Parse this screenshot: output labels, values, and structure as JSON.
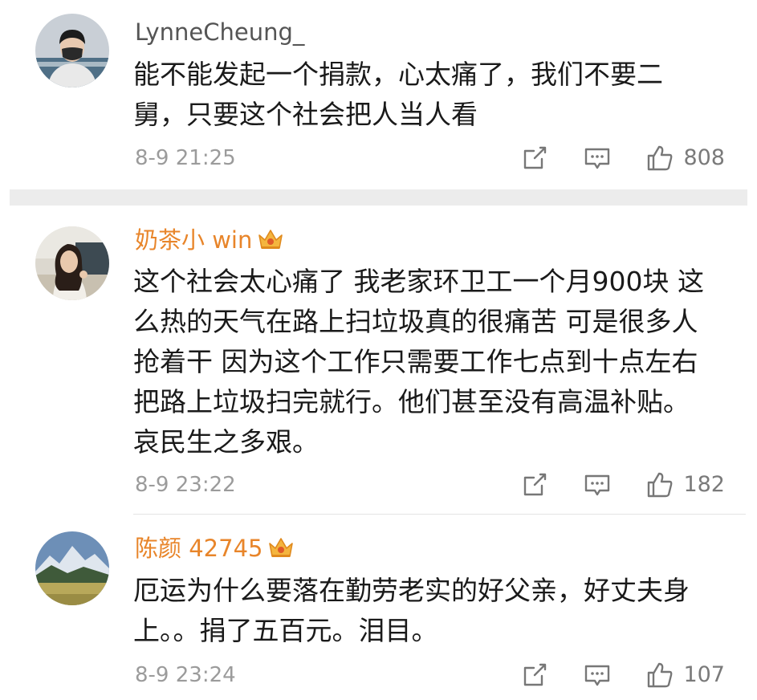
{
  "comments": [
    {
      "username": "LynneCheung_",
      "vip": false,
      "text": "能不能发起一个捐款，心太痛了，我们不要二\n舅，只要这个社会把人当人看",
      "time": "8-9 21:25",
      "likes": "808",
      "avatar": "avatar-person-mask"
    },
    {
      "username": "奶茶小 win",
      "vip": true,
      "text": "这个社会太心痛了 我老家环卫工一个月900块 这\n么热的天气在路上扫垃圾真的很痛苦 可是很多人\n抢着干 因为这个工作只需要工作七点到十点左右\n把路上垃圾扫完就行。他们甚至没有高温补贴。\n哀民生之多艰。",
      "time": "8-9 23:22",
      "likes": "182",
      "avatar": "avatar-girl"
    },
    {
      "username": "陈颜 42745",
      "vip": true,
      "text": "厄运为什么要落在勤劳老实的好父亲，好丈夫身\n上。。捐了五百元。泪目。",
      "time": "8-9 23:24",
      "likes": "107",
      "avatar": "avatar-mountain"
    }
  ],
  "colors": {
    "vip_name": "#e8852a",
    "plain_name": "#555555",
    "text": "#1a1a1a",
    "meta": "#9b9b9b",
    "separator": "#ececec"
  },
  "icons": [
    "share-icon",
    "comment-icon",
    "thumbs-up-icon",
    "vip-crown-icon"
  ]
}
